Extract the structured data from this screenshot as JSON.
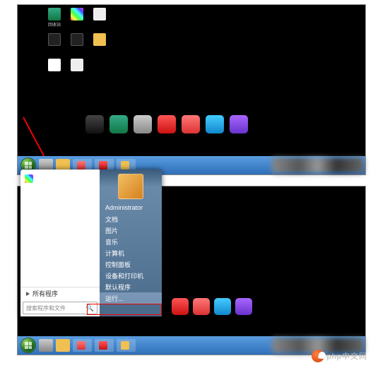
{
  "annotation": {
    "type": "tutorial-composite",
    "arrow_target": "start-button",
    "highlight_target": "run-menu-item"
  },
  "top_panel": {
    "desktop_icons": [
      {
        "name": "recycle-bin",
        "label": "回收站",
        "color": "c-recy"
      },
      {
        "name": "rainbow-app",
        "label": "",
        "color": "c-rainbow"
      },
      {
        "name": "app-3",
        "label": "",
        "color": "c-white"
      },
      {
        "name": "app-4",
        "label": "",
        "color": "c-dark"
      },
      {
        "name": "app-5",
        "label": "",
        "color": "c-dark"
      },
      {
        "name": "app-6",
        "label": "",
        "color": "c-folder"
      },
      {
        "name": "cloud-app",
        "label": "",
        "color": "c-cloud"
      },
      {
        "name": "app-8",
        "label": "",
        "color": "c-white"
      }
    ],
    "dock_icons": [
      {
        "name": "steam",
        "color": "c-steam",
        "label": ""
      },
      {
        "name": "recycle",
        "color": "c-recy",
        "label": ""
      },
      {
        "name": "app-a",
        "color": "c-silver",
        "label": ""
      },
      {
        "name": "app-b",
        "color": "c-red",
        "label": ""
      },
      {
        "name": "app-c",
        "color": "c-redo",
        "label": ""
      },
      {
        "name": "app-d",
        "color": "c-cyan",
        "label": ""
      },
      {
        "name": "app-e",
        "color": "c-purple",
        "label": ""
      }
    ],
    "taskbar": {
      "pinned": [
        "item1",
        "item2"
      ],
      "running": [
        {
          "name": "task-1",
          "color": "c-redo",
          "label": ""
        },
        {
          "name": "task-2",
          "color": "c-red",
          "label": ""
        },
        {
          "name": "task-3",
          "color": "c-folder",
          "label": ""
        }
      ]
    }
  },
  "bottom_panel": {
    "start_menu": {
      "user_name": "Administrator",
      "left_programs": [
        {
          "name": "prog-1",
          "label": "",
          "color": "c-rainbow"
        }
      ],
      "all_programs_label": "所有程序",
      "search_placeholder": "搜索程序和文件",
      "right_items": [
        {
          "key": "user",
          "label": "Administrator"
        },
        {
          "key": "documents",
          "label": "文档"
        },
        {
          "key": "pictures",
          "label": "图片"
        },
        {
          "key": "music",
          "label": "音乐"
        },
        {
          "key": "computer",
          "label": "计算机"
        },
        {
          "key": "control_panel",
          "label": "控制面板"
        },
        {
          "key": "devices",
          "label": "设备和打印机"
        },
        {
          "key": "default_programs",
          "label": "默认程序"
        },
        {
          "key": "run",
          "label": "运行...",
          "highlighted": true
        }
      ]
    },
    "dock_icons": [
      {
        "name": "app-b",
        "color": "c-red"
      },
      {
        "name": "app-c",
        "color": "c-redo"
      },
      {
        "name": "app-d",
        "color": "c-cyan"
      },
      {
        "name": "app-e",
        "color": "c-purple"
      }
    ],
    "taskbar": {
      "pinned": [
        "item1",
        "item2"
      ],
      "running": [
        {
          "name": "task-1",
          "color": "c-redo"
        },
        {
          "name": "task-2",
          "color": "c-red"
        },
        {
          "name": "task-3",
          "color": "c-folder"
        }
      ]
    }
  },
  "watermark": {
    "text": "php中文网"
  }
}
